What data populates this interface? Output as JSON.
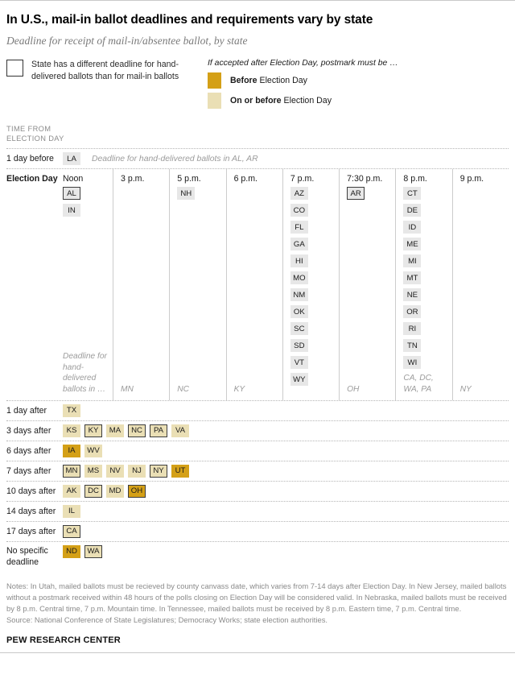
{
  "header": {
    "title": "In U.S., mail-in ballot deadlines and requirements vary by state",
    "subtitle": "Deadline for receipt of mail-in/absentee ballot, by state"
  },
  "legend": {
    "box_note": "State has a different deadline for hand-delivered ballots than for mail-in ballots",
    "postmark_heading": "If accepted after Election Day, postmark must be …",
    "items": [
      {
        "key": "before",
        "bold": "Before",
        "rest": " Election Day",
        "color": "#d4a017"
      },
      {
        "key": "on_or_before",
        "bold": "On or before",
        "rest": " Election Day",
        "color": "#eadfb5"
      }
    ]
  },
  "axis_caption": "TIME FROM\nELECTION DAY",
  "colors": {
    "gray_chip": "#e7e7e7",
    "light_gold": "#eadfb5",
    "dark_gold": "#d4a017",
    "chip_border": "#3d3d3d",
    "muted_text": "#9b9b9b"
  },
  "rows": {
    "day_before": {
      "label": "1 day before",
      "chips": [
        {
          "code": "LA",
          "fill": "gray",
          "bordered": false
        }
      ],
      "note": "Deadline for hand-delivered ballots in AL, AR"
    },
    "election_day": {
      "label": "Election Day",
      "columns": [
        {
          "time": "Noon",
          "chips": [
            {
              "code": "AL",
              "fill": "gray",
              "bordered": true
            },
            {
              "code": "IN",
              "fill": "gray",
              "bordered": false
            }
          ],
          "footer": "Deadline for hand-delivered ballots in …"
        },
        {
          "time": "3 p.m.",
          "chips": [],
          "footer": "MN"
        },
        {
          "time": "5 p.m.",
          "chips": [
            {
              "code": "NH",
              "fill": "gray",
              "bordered": false
            }
          ],
          "footer": "NC"
        },
        {
          "time": "6 p.m.",
          "chips": [],
          "footer": "KY"
        },
        {
          "time": "7 p.m.",
          "chips": [
            {
              "code": "AZ",
              "fill": "gray",
              "bordered": false
            },
            {
              "code": "CO",
              "fill": "gray",
              "bordered": false
            },
            {
              "code": "FL",
              "fill": "gray",
              "bordered": false
            },
            {
              "code": "GA",
              "fill": "gray",
              "bordered": false
            },
            {
              "code": "HI",
              "fill": "gray",
              "bordered": false
            },
            {
              "code": "MO",
              "fill": "gray",
              "bordered": false
            },
            {
              "code": "NM",
              "fill": "gray",
              "bordered": false
            },
            {
              "code": "OK",
              "fill": "gray",
              "bordered": false
            },
            {
              "code": "SC",
              "fill": "gray",
              "bordered": false
            },
            {
              "code": "SD",
              "fill": "gray",
              "bordered": false
            },
            {
              "code": "VT",
              "fill": "gray",
              "bordered": false
            },
            {
              "code": "WY",
              "fill": "gray",
              "bordered": false
            }
          ],
          "footer": ""
        },
        {
          "time": "7:30 p.m.",
          "chips": [
            {
              "code": "AR",
              "fill": "gray",
              "bordered": true
            }
          ],
          "footer": "OH"
        },
        {
          "time": "8 p.m.",
          "chips": [
            {
              "code": "CT",
              "fill": "gray",
              "bordered": false
            },
            {
              "code": "DE",
              "fill": "gray",
              "bordered": false
            },
            {
              "code": "ID",
              "fill": "gray",
              "bordered": false
            },
            {
              "code": "ME",
              "fill": "gray",
              "bordered": false
            },
            {
              "code": "MI",
              "fill": "gray",
              "bordered": false
            },
            {
              "code": "MT",
              "fill": "gray",
              "bordered": false
            },
            {
              "code": "NE",
              "fill": "gray",
              "bordered": false
            },
            {
              "code": "OR",
              "fill": "gray",
              "bordered": false
            },
            {
              "code": "RI",
              "fill": "gray",
              "bordered": false
            },
            {
              "code": "TN",
              "fill": "gray",
              "bordered": false
            },
            {
              "code": "WI",
              "fill": "gray",
              "bordered": false
            }
          ],
          "footer": "CA, DC, WA, PA"
        },
        {
          "time": "9 p.m.",
          "chips": [],
          "footer": "NY"
        }
      ]
    },
    "after": [
      {
        "label": "1 day after",
        "chips": [
          {
            "code": "TX",
            "fill": "light",
            "bordered": false
          }
        ]
      },
      {
        "label": "3 days after",
        "chips": [
          {
            "code": "KS",
            "fill": "light",
            "bordered": false
          },
          {
            "code": "KY",
            "fill": "light",
            "bordered": true
          },
          {
            "code": "MA",
            "fill": "light",
            "bordered": false
          },
          {
            "code": "NC",
            "fill": "light",
            "bordered": true
          },
          {
            "code": "PA",
            "fill": "light",
            "bordered": true
          },
          {
            "code": "VA",
            "fill": "light",
            "bordered": false
          }
        ]
      },
      {
        "label": "6 days after",
        "chips": [
          {
            "code": "IA",
            "fill": "dark",
            "bordered": false
          },
          {
            "code": "WV",
            "fill": "light",
            "bordered": false
          }
        ]
      },
      {
        "label": "7 days after",
        "chips": [
          {
            "code": "MN",
            "fill": "light",
            "bordered": true
          },
          {
            "code": "MS",
            "fill": "light",
            "bordered": false
          },
          {
            "code": "NV",
            "fill": "light",
            "bordered": false
          },
          {
            "code": "NJ",
            "fill": "light",
            "bordered": false
          },
          {
            "code": "NY",
            "fill": "light",
            "bordered": true
          },
          {
            "code": "UT",
            "fill": "dark",
            "bordered": false
          }
        ]
      },
      {
        "label": "10 days after",
        "chips": [
          {
            "code": "AK",
            "fill": "light",
            "bordered": false
          },
          {
            "code": "DC",
            "fill": "light",
            "bordered": true
          },
          {
            "code": "MD",
            "fill": "light",
            "bordered": false
          },
          {
            "code": "OH",
            "fill": "dark",
            "bordered": true
          }
        ]
      },
      {
        "label": "14 days after",
        "chips": [
          {
            "code": "IL",
            "fill": "light",
            "bordered": false
          }
        ]
      },
      {
        "label": "17 days after",
        "chips": [
          {
            "code": "CA",
            "fill": "light",
            "bordered": true
          }
        ]
      },
      {
        "label": "No specific deadline",
        "chips": [
          {
            "code": "ND",
            "fill": "dark",
            "bordered": false
          },
          {
            "code": "WA",
            "fill": "light",
            "bordered": true
          }
        ]
      }
    ]
  },
  "footer": {
    "notes": "Notes: In Utah, mailed ballots must be recieved by county canvass date, which varies from 7-14 days after Election Day. In New Jersey, mailed ballots without a postmark received within 48 hours of the polls closing on Election Day will be considered valid. In Nebraska, mailed ballots must be received by 8 p.m. Central time, 7 p.m. Mountain time. In Tennessee, mailed ballots must be received by 8 p.m. Eastern time, 7 p.m. Central time.",
    "source": "Source: National Conference of State Legislatures; Democracy Works; state election authorities.",
    "brand": "PEW RESEARCH CENTER"
  }
}
